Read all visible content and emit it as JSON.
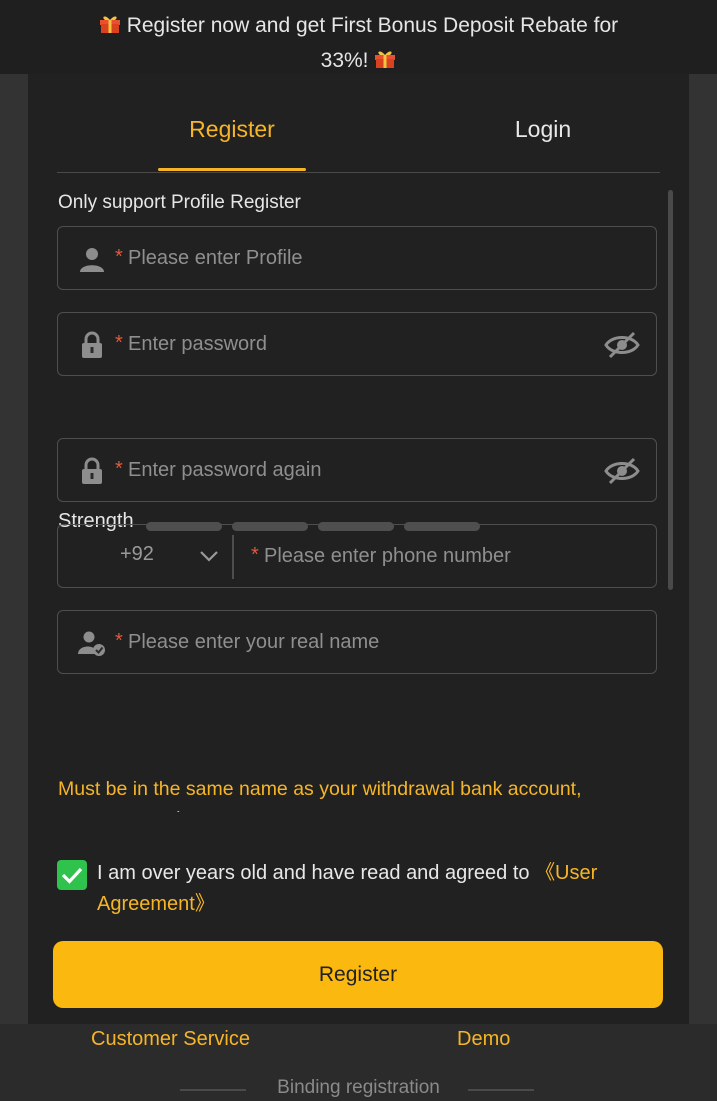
{
  "banner": {
    "text_line1": "Register now and get First Bonus Deposit Rebate for",
    "text_line2": "33%!"
  },
  "tabs": [
    {
      "label": "Register"
    },
    {
      "label": "Login"
    }
  ],
  "form": {
    "hint": "Only support Profile Register",
    "required_mark": "*",
    "profile": {
      "placeholder": "Please enter Profile",
      "icon": "person-icon"
    },
    "password": {
      "placeholder": "Enter password",
      "icon": "lock-icon",
      "toggle_icon": "eye-off-icon"
    },
    "strength": {
      "label": "Strength",
      "level": 0,
      "segments": 4
    },
    "password_again": {
      "placeholder": "Enter password again",
      "icon": "lock-icon",
      "toggle_icon": "eye-off-icon"
    },
    "phone": {
      "country_code": "+92",
      "placeholder": "Please enter phone number"
    },
    "real_name": {
      "placeholder": "Please enter your real name",
      "icon": "verified-user-icon"
    },
    "warning": "Must be in the same name as your withdrawal bank account, uppercase only",
    "agreement": {
      "checked": true,
      "text": "I am over years old and have read and agreed to ",
      "link": "《User Agreement》"
    },
    "submit_label": "Register"
  },
  "footer": {
    "customer_service": "Customer Service",
    "demo": "Demo",
    "binding": "Binding registration"
  },
  "colors": {
    "accent": "#f6b527",
    "button": "#fbb80f",
    "check": "#2fc24d",
    "required": "#e05a3c"
  }
}
